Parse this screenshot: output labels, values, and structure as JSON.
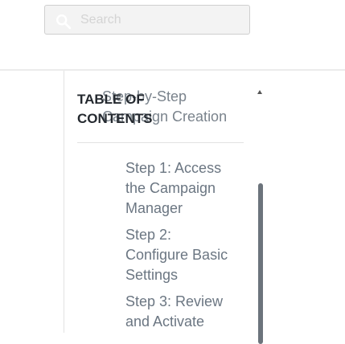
{
  "search": {
    "placeholder": "Search",
    "icon": "search-icon"
  },
  "toc": {
    "title": "TABLE OF CONTENTS",
    "parent_item": "Step-by-Step Campaign Creation",
    "items": [
      {
        "label": "Step 1: Access the Campaign Manager"
      },
      {
        "label": "Step 2: Configure Basic Settings"
      },
      {
        "label": "Step 3: Review and Activate"
      }
    ]
  },
  "colors": {
    "toc_title": "#24292f",
    "toc_link": "#6b7682",
    "scrollbar_thumb": "#6c747c"
  }
}
